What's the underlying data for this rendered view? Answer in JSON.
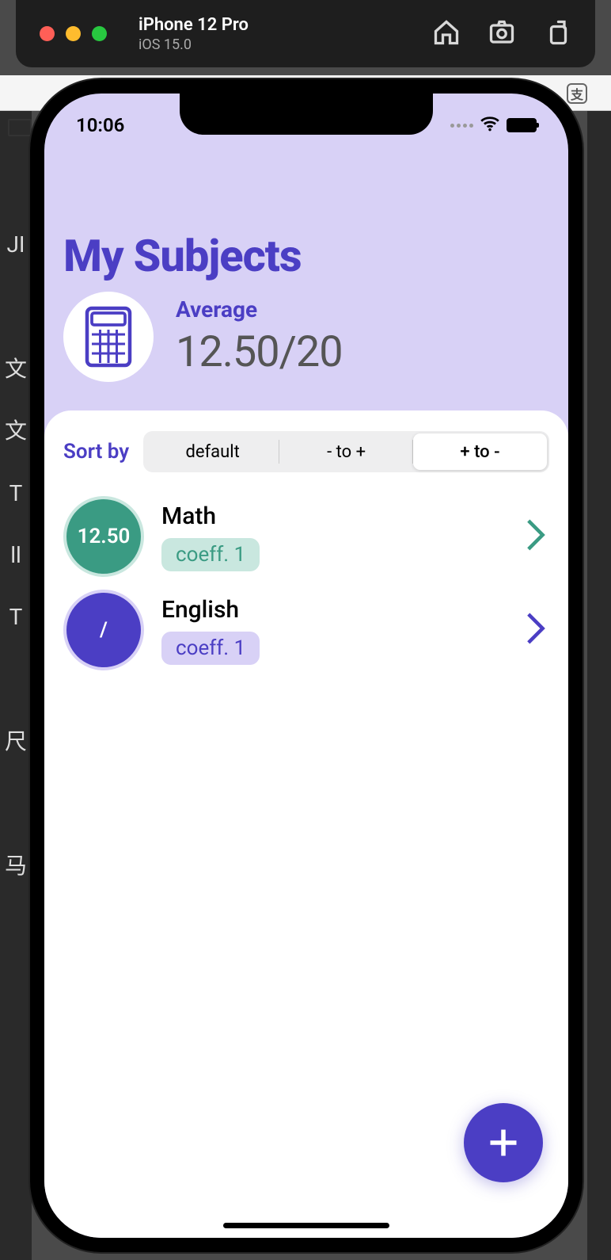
{
  "simulator": {
    "device": "iPhone 12 Pro",
    "os": "iOS 15.0"
  },
  "status": {
    "time": "10:06"
  },
  "page": {
    "title": "My Subjects"
  },
  "average": {
    "label": "Average",
    "value": "12.50/20"
  },
  "sort": {
    "label": "Sort by",
    "options": [
      "default",
      "- to +",
      "+ to -"
    ],
    "active_index": 2
  },
  "subjects": [
    {
      "name": "Math",
      "score": "12.50",
      "coeff": "coeff. 1",
      "color": "teal"
    },
    {
      "name": "English",
      "score": "/",
      "coeff": "coeff. 1",
      "color": "indigo"
    }
  ]
}
